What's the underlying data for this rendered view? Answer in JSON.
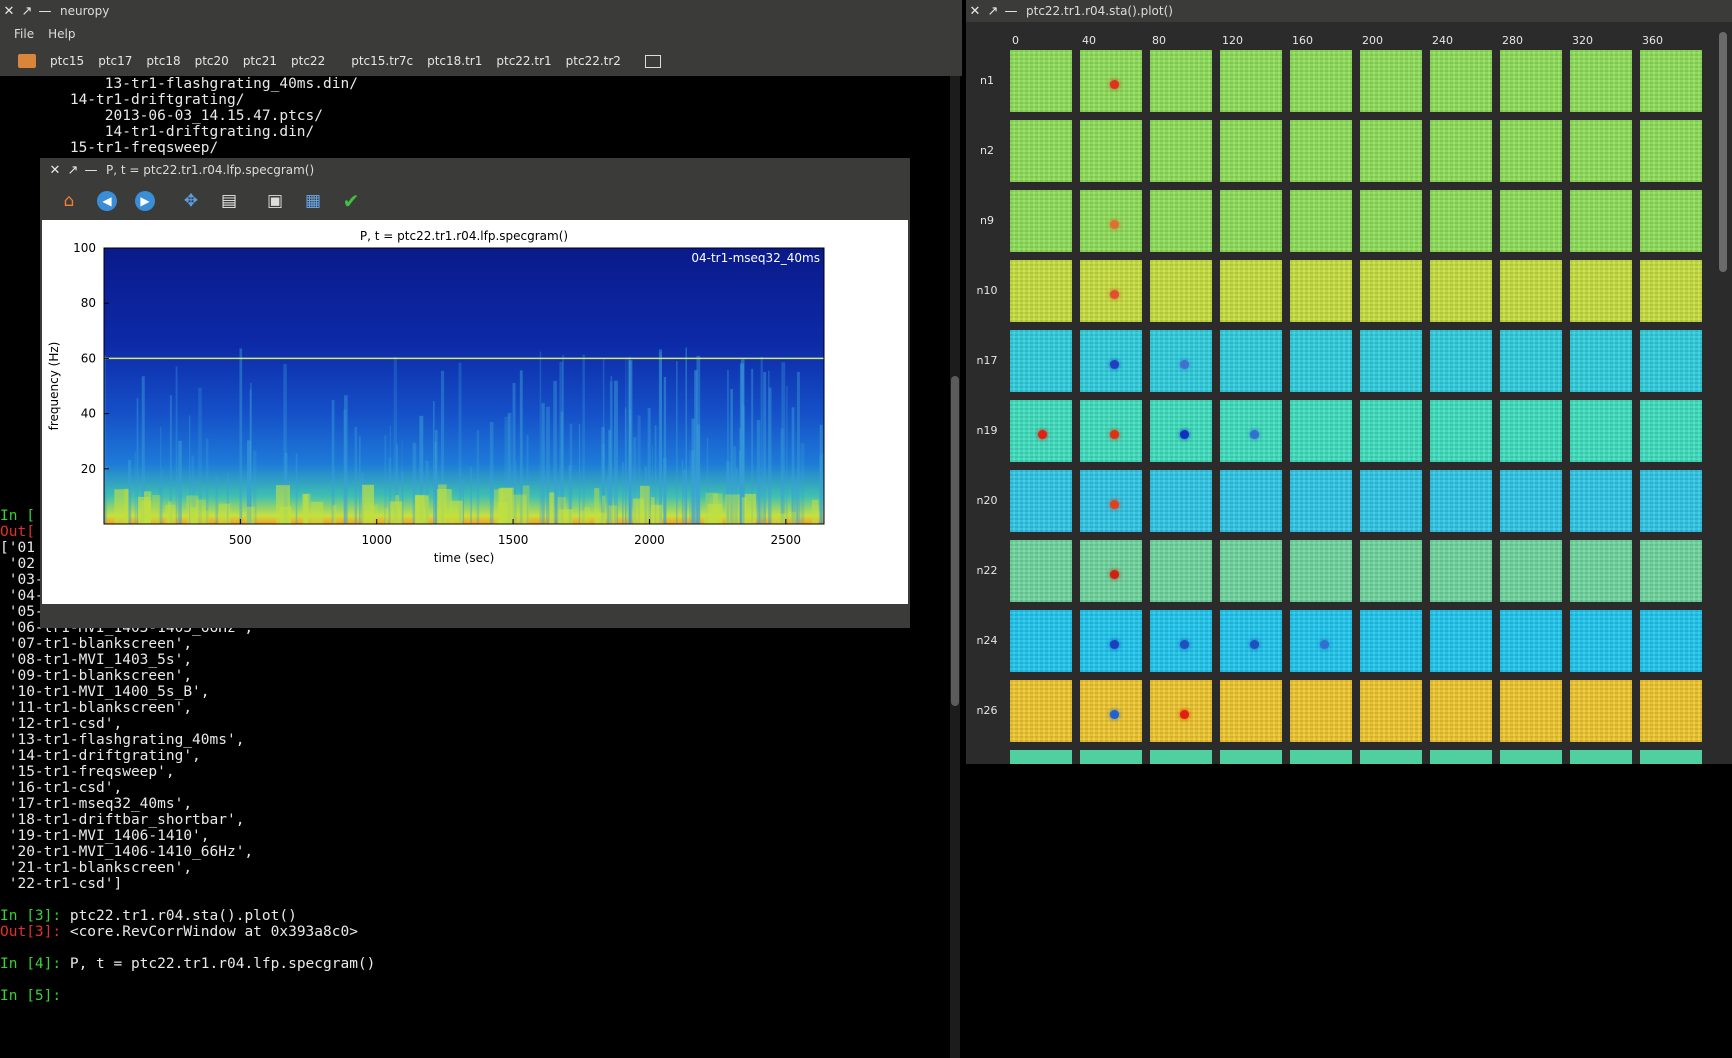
{
  "left_window": {
    "title": "neuropy",
    "close": "✕",
    "restore": "↗",
    "minimize": "—",
    "menu": [
      "File",
      "Help"
    ],
    "tabs": [
      "ptc15",
      "ptc17",
      "ptc18",
      "ptc20",
      "ptc21",
      "ptc22",
      "ptc15.tr7c",
      "ptc18.tr1",
      "ptc22.tr1",
      "ptc22.tr2"
    ]
  },
  "terminal": {
    "lines": [
      {
        "t": "            13-tr1-flashgrating_40ms.din/",
        "c": ""
      },
      {
        "t": "        14-tr1-driftgrating/",
        "c": ""
      },
      {
        "t": "            2013-06-03_14.15.47.ptcs/",
        "c": ""
      },
      {
        "t": "            14-tr1-driftgrating.din/",
        "c": ""
      },
      {
        "t": "        15-tr1-freqsweep/",
        "c": ""
      },
      {
        "t": "",
        "c": ""
      },
      {
        "t": "",
        "c": ""
      },
      {
        "t": "",
        "c": ""
      },
      {
        "t": "",
        "c": ""
      },
      {
        "t": "",
        "c": ""
      },
      {
        "t": "",
        "c": ""
      },
      {
        "t": "",
        "c": ""
      },
      {
        "t": "",
        "c": ""
      },
      {
        "t": "",
        "c": ""
      },
      {
        "t": "",
        "c": ""
      },
      {
        "t": "",
        "c": ""
      },
      {
        "t": "",
        "c": ""
      },
      {
        "t": "",
        "c": ""
      },
      {
        "t": "",
        "c": ""
      },
      {
        "t": "",
        "c": ""
      },
      {
        "t": "",
        "c": ""
      },
      {
        "t": "",
        "c": ""
      },
      {
        "t": "",
        "c": ""
      },
      {
        "t": "",
        "c": ""
      },
      {
        "t": "",
        "c": ""
      },
      {
        "t": "",
        "c": ""
      },
      {
        "t": "",
        "c": ""
      },
      {
        "t": "In [",
        "c": "g"
      },
      {
        "t": "Out[",
        "c": "r"
      },
      {
        "t": "['01",
        "c": ""
      },
      {
        "t": " '02",
        "c": ""
      },
      {
        "t": " '03-tr1-driftbar_shortbar',",
        "c": ""
      },
      {
        "t": " '04-tr1-mseq32_40ms',",
        "c": ""
      },
      {
        "t": " '05-tr1-MVI_1403-1405',",
        "c": ""
      },
      {
        "t": " '06-tr1-MVI_1403-1405_66Hz',",
        "c": ""
      },
      {
        "t": " '07-tr1-blankscreen',",
        "c": ""
      },
      {
        "t": " '08-tr1-MVI_1403_5s',",
        "c": ""
      },
      {
        "t": " '09-tr1-blankscreen',",
        "c": ""
      },
      {
        "t": " '10-tr1-MVI_1400_5s_B',",
        "c": ""
      },
      {
        "t": " '11-tr1-blankscreen',",
        "c": ""
      },
      {
        "t": " '12-tr1-csd',",
        "c": ""
      },
      {
        "t": " '13-tr1-flashgrating_40ms',",
        "c": ""
      },
      {
        "t": " '14-tr1-driftgrating',",
        "c": ""
      },
      {
        "t": " '15-tr1-freqsweep',",
        "c": ""
      },
      {
        "t": " '16-tr1-csd',",
        "c": ""
      },
      {
        "t": " '17-tr1-mseq32_40ms',",
        "c": ""
      },
      {
        "t": " '18-tr1-driftbar_shortbar',",
        "c": ""
      },
      {
        "t": " '19-tr1-MVI_1406-1410',",
        "c": ""
      },
      {
        "t": " '20-tr1-MVI_1406-1410_66Hz',",
        "c": ""
      },
      {
        "t": " '21-tr1-blankscreen',",
        "c": ""
      },
      {
        "t": " '22-tr1-csd']",
        "c": ""
      },
      {
        "t": "",
        "c": ""
      },
      {
        "t": "In [3]: ",
        "c": "g",
        "rest": "ptc22.tr1.r04.sta().plot()"
      },
      {
        "t": "Out[3]: ",
        "c": "r",
        "rest": "<core.RevCorrWindow at 0x393a8c0>"
      },
      {
        "t": "",
        "c": ""
      },
      {
        "t": "In [4]: ",
        "c": "g",
        "rest": "P, t = ptc22.tr1.r04.lfp.specgram()"
      },
      {
        "t": "",
        "c": ""
      },
      {
        "t": "In [5]: ",
        "c": "g",
        "rest": ""
      }
    ]
  },
  "spec_window": {
    "title": "P, t = ptc22.tr1.r04.lfp.specgram()",
    "toolbar_icons": [
      "home-icon",
      "back-icon",
      "forward-icon",
      "pan-icon",
      "zoom-icon",
      "subplots-icon",
      "save-icon",
      "check-icon"
    ]
  },
  "chart_data": {
    "type": "heatmap",
    "title": "P, t = ptc22.tr1.r04.lfp.specgram()",
    "annotation": "04-tr1-mseq32_40ms",
    "xlabel": "time (sec)",
    "ylabel": "frequency (Hz)",
    "xticks": [
      500,
      1000,
      1500,
      2000,
      2500
    ],
    "yticks": [
      20,
      40,
      60,
      80,
      100
    ],
    "xlim": [
      0,
      2640
    ],
    "ylim": [
      0,
      100
    ],
    "line_noise_hz": 60,
    "colormap": "jet"
  },
  "sta_window": {
    "title": "ptc22.tr1.r04.sta().plot()",
    "col_labels": [
      "0",
      "40",
      "80",
      "120",
      "160",
      "200",
      "240",
      "280",
      "320",
      "360"
    ],
    "rows": [
      {
        "label": "n1",
        "base": "#8fe05a",
        "spots": {
          "1": "#e03020"
        }
      },
      {
        "label": "n2",
        "base": "#8fe05a",
        "spots": {}
      },
      {
        "label": "n9",
        "base": "#8fe05a",
        "spots": {
          "1": "#e07030"
        }
      },
      {
        "label": "n10",
        "base": "#c8e040",
        "spots": {
          "1": "#e05030"
        }
      },
      {
        "label": "n17",
        "base": "#30d0e0",
        "spots": {
          "1": "#2040c0",
          "2": "#4070d0"
        }
      },
      {
        "label": "n19",
        "base": "#40e0c0",
        "spots": {
          "0": "#e02010",
          "1": "#e03010",
          "2": "#1030c0",
          "3": "#3070d0"
        }
      },
      {
        "label": "n20",
        "base": "#30c8e8",
        "spots": {
          "1": "#e04020"
        }
      },
      {
        "label": "n22",
        "base": "#70d8a0",
        "spots": {
          "1": "#d02010"
        }
      },
      {
        "label": "n24",
        "base": "#20c8f0",
        "spots": {
          "1": "#1840c0",
          "2": "#2050c0",
          "3": "#2050c0",
          "4": "#3070d0"
        }
      },
      {
        "label": "n26",
        "base": "#f0c830",
        "spots": {
          "1": "#2060d0",
          "2": "#e02010"
        }
      }
    ]
  }
}
